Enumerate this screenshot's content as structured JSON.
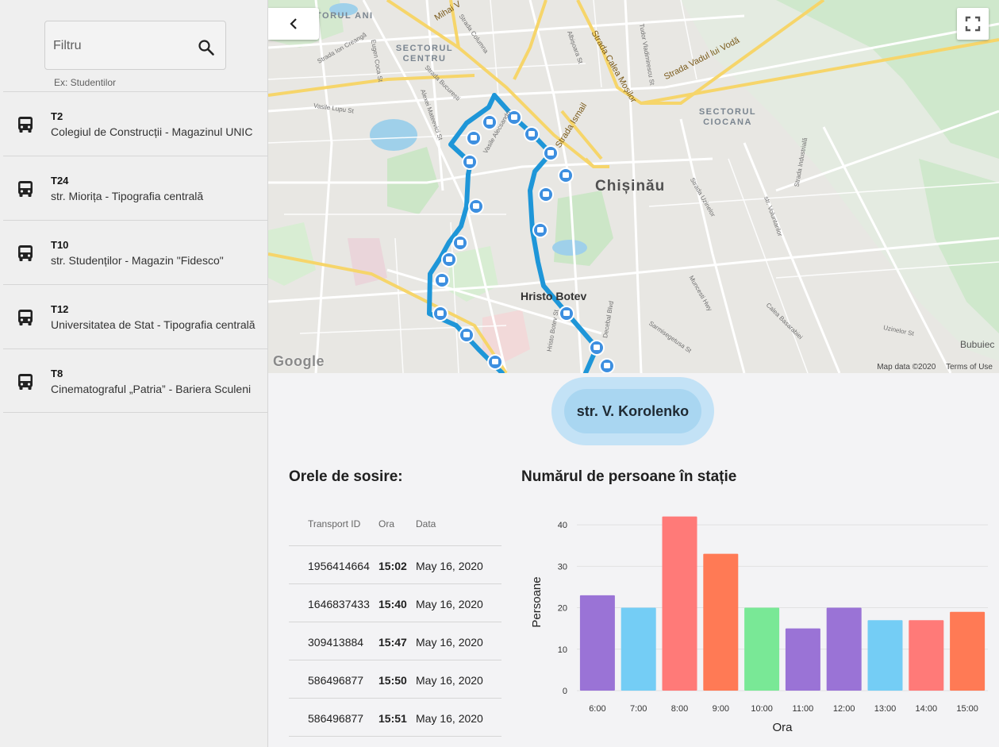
{
  "sidebar": {
    "search_placeholder": "Filtru",
    "search_hint": "Ex: Studentilor",
    "routes": [
      {
        "code": "T2",
        "name": "Colegiul de Construcții - Magazinul UNIC"
      },
      {
        "code": "T24",
        "name": "str. Miorița - Tipografia centrală"
      },
      {
        "code": "T10",
        "name": "str. Studenților - Magazin \"Fidesco\""
      },
      {
        "code": "T12",
        "name": "Universitatea de Stat - Tipografia centrală"
      },
      {
        "code": "T8",
        "name": "Cinematograful „Patria” - Bariera Sculeni"
      }
    ]
  },
  "map": {
    "labels": {
      "sector_centru": "SECTORUL CENTRU",
      "sector_ciocana": "SECTORUL CIOCANA",
      "sector_top": "TORUL ANI",
      "city": "Chișinău",
      "hristo_botev": "Hristo Botev",
      "bubuieci": "Bubuiec",
      "mihai_v": "Mihai V",
      "strada_calea_mosilor": "Strada Calea Moșilor",
      "strada_vadul_lui_voda": "Strada Vadul lui Vodă",
      "strada_ismail": "Strada Ismail",
      "strada_columna": "Strada Columna",
      "strada_bucuresti": "Strada București",
      "strada_ion_creanga": "Strada Ion Creangă",
      "eugen_coca": "Eugen Coca St",
      "vasile_lupu": "Vasile Lupu St",
      "alexei_mateevici": "Alexei Mateevici St",
      "strada_uzinelor": "Strada Uzinelor",
      "str_voluntarilor": "str. Voluntarilor",
      "strada_industriala": "Strada Industrială",
      "calea_basarabiei": "Calea Basarabiei",
      "uzinelor_st": "Uzinelor St",
      "decebal": "Decebal Blvd",
      "hristo_botev_st": "Hristo Botev St",
      "sarmisegetusa": "Sarmisegetusa St",
      "muncesti": "Muncesti Hwy",
      "albisoara": "Albișoara St",
      "tudor_vladimirescu": "Tudor Vladimirescu St",
      "vasile_alecsandri": "Vasile Alecsandri"
    },
    "google_logo": "Google",
    "attribution": "Map data ©2020",
    "terms": "Terms of Use",
    "route_color": "#1e96d8"
  },
  "station": {
    "name": "str. V. Korolenko"
  },
  "arrivals": {
    "title": "Orele de sosire:",
    "headers": [
      "Transport ID",
      "Ora",
      "Data"
    ],
    "rows": [
      [
        "1956414664",
        "15:02",
        "May 16, 2020"
      ],
      [
        "1646837433",
        "15:40",
        "May 16, 2020"
      ],
      [
        "309413884",
        "15:47",
        "May 16, 2020"
      ],
      [
        "586496877",
        "15:50",
        "May 16, 2020"
      ],
      [
        "586496877",
        "15:51",
        "May 16, 2020"
      ]
    ]
  },
  "chart_data": {
    "type": "bar",
    "title": "Numărul de persoane în stație",
    "xlabel": "Ora",
    "ylabel": "Persoane",
    "categories": [
      "6:00",
      "7:00",
      "8:00",
      "9:00",
      "10:00",
      "11:00",
      "12:00",
      "13:00",
      "14:00",
      "15:00"
    ],
    "values": [
      23,
      20,
      42,
      33,
      20,
      15,
      20,
      17,
      17,
      19
    ],
    "ylim": [
      0,
      45
    ],
    "yticks": [
      0,
      10,
      20,
      30,
      40
    ],
    "grid": true,
    "bar_colors": [
      "#9a73d6",
      "#74cdf5",
      "#ff7a78",
      "#ff7a55",
      "#79e896",
      "#9a73d6",
      "#9a73d6",
      "#74cdf5",
      "#ff7a78",
      "#ff7a55"
    ]
  }
}
